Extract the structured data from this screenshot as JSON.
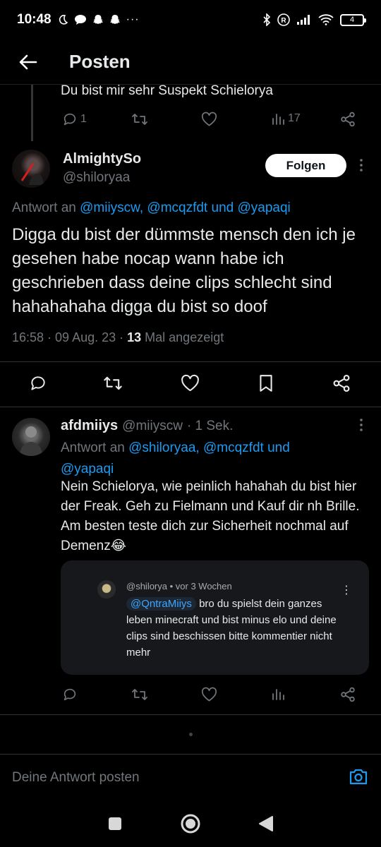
{
  "status_bar": {
    "time": "10:48",
    "battery": "4"
  },
  "header": {
    "title": "Posten"
  },
  "parent_post": {
    "text": "Du bist mir sehr Suspekt Schielorya",
    "reply_count": "1",
    "view_count": "17"
  },
  "main_post": {
    "name": "AlmightySo",
    "handle": "@shiloryaa",
    "follow_label": "Folgen",
    "reply_to_prefix": "Antwort an",
    "reply_to_mentions": [
      "@miiyscw,",
      "@mcqzfdt",
      "und",
      "@yapaqi"
    ],
    "text": "Digga du bist der dümmste mensch den ich je gesehen habe nocap wann habe ich geschrieben dass deine clips schlecht sind hahahahaha digga du bist so doof",
    "timestamp": "16:58 · 09 Aug. 23 · ",
    "view_count": "13",
    "view_suffix": " Mal angezeigt"
  },
  "reply_post": {
    "name": "afdmiiys",
    "handle": "@miiyscw",
    "time": "· 1 Sek.",
    "reply_to_prefix": "Antwort an",
    "reply_to_line1": "@shiloryaa, @mcqzfdt",
    "reply_to_und": "und",
    "reply_to_line2": "@yapaqi",
    "text": "Nein Schielorya, wie peinlich hahahah du bist hier der Freak. Geh zu Fielmann und Kauf dir nh Brille. Am besten teste dich zur Sicherheit nochmal auf Demenz😂",
    "quote": {
      "header": "@shilorya • vor 3 Wochen",
      "mention": "@QntraMiiys",
      "text": " bro du spielst dein ganzes leben minecraft und bist minus elo und deine clips sind beschissen bitte kommentier nicht mehr",
      "dots": "⋮"
    }
  },
  "compose": {
    "placeholder": "Deine Antwort posten"
  },
  "colors": {
    "accent": "#1d9bf0",
    "background": "#000000",
    "muted": "#71767b"
  }
}
